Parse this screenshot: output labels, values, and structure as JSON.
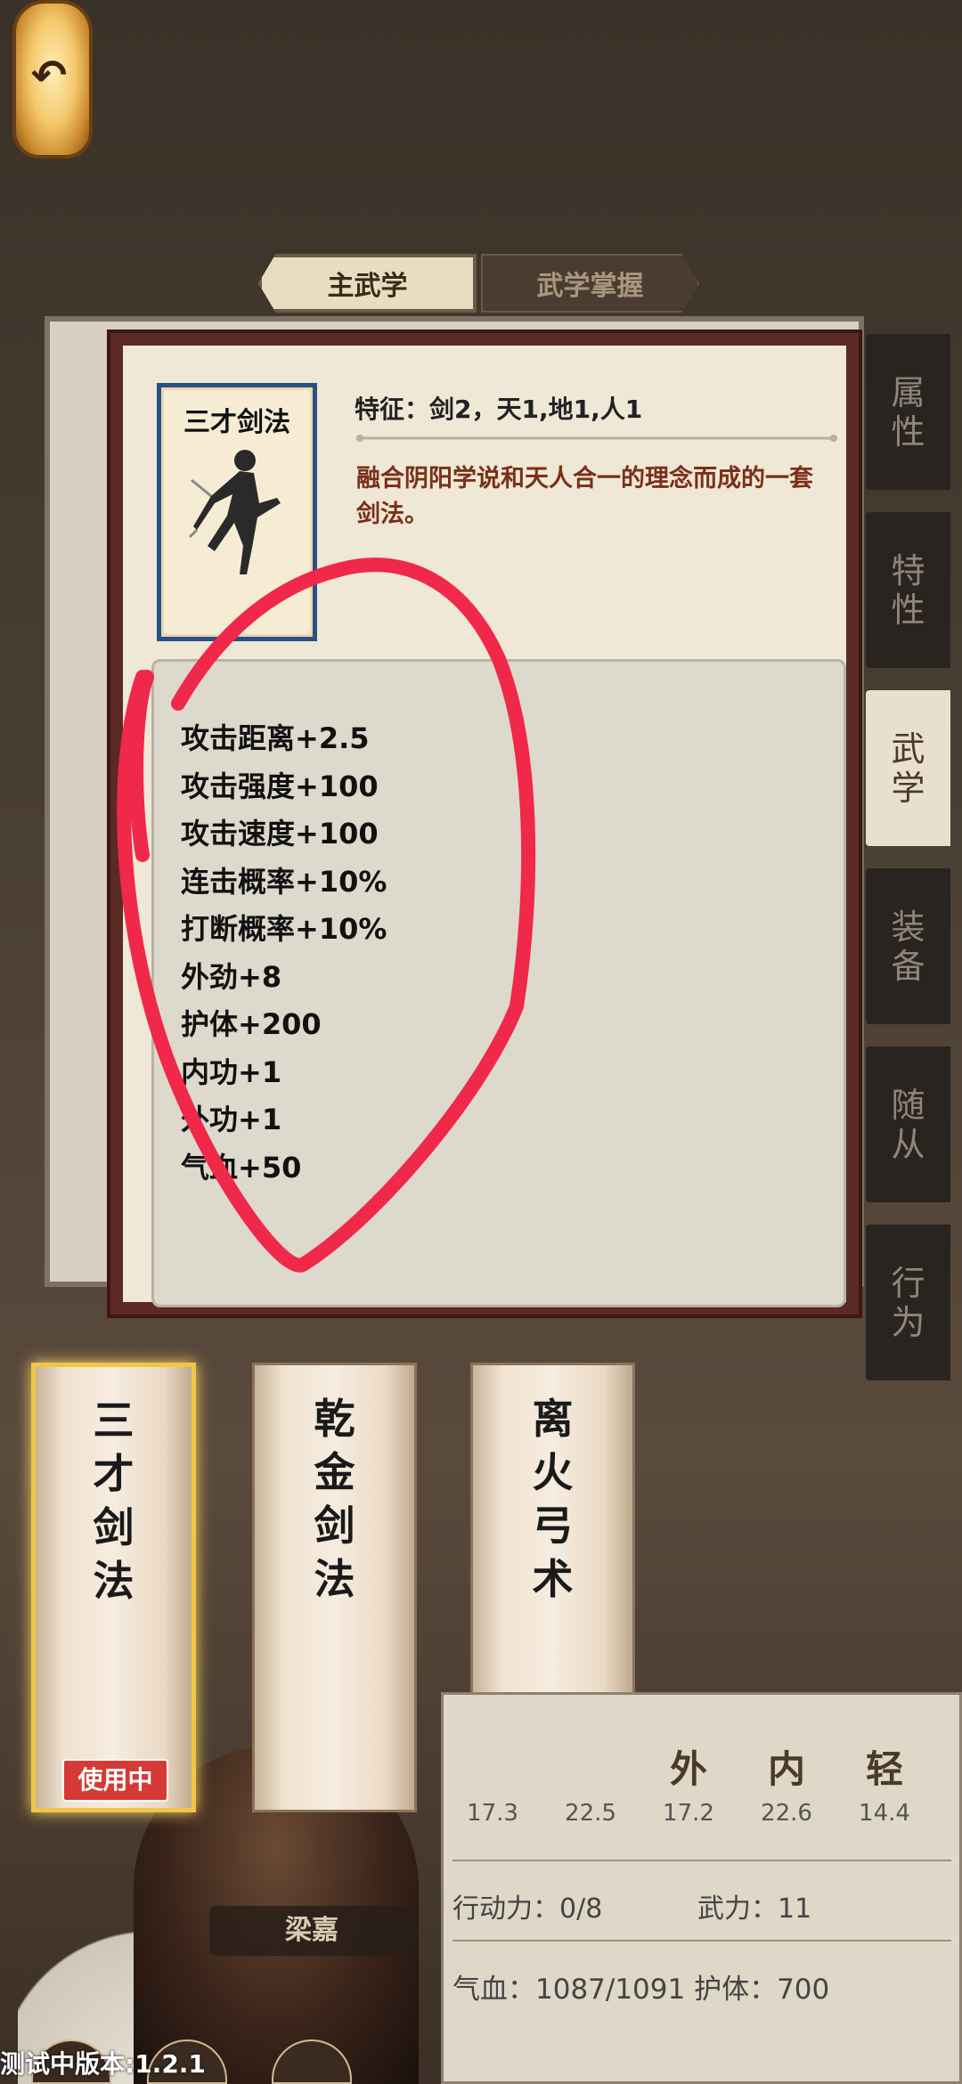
{
  "tabs": {
    "main": "主武学",
    "master": "武学掌握"
  },
  "side_tabs": [
    "属性",
    "特性",
    "武学",
    "装备",
    "随从",
    "行为"
  ],
  "active_side_tab": "武学",
  "popup": {
    "skill_name": "三才剑法",
    "feature": "特征：剑2，天1,地1,人1",
    "description": "融合阴阳学说和天人合一的理念而成的一套剑法。",
    "stats": [
      "攻击距离+2.5",
      "攻击强度+100",
      "攻击速度+100",
      "连击概率+10%",
      "打断概率+10%",
      "外劲+8",
      "护体+200",
      "内功+1",
      "外功+1",
      "气血+50"
    ]
  },
  "skills": [
    {
      "name": "三才剑法",
      "badge": "使用中"
    },
    {
      "name": "乾金剑法"
    },
    {
      "name": "离火弓术"
    }
  ],
  "character": {
    "name": "梁嘉",
    "attributes": [
      {
        "label": "",
        "value": "17.3"
      },
      {
        "label": "",
        "value": "22.5"
      },
      {
        "label": "外",
        "value": "17.2"
      },
      {
        "label": "内",
        "value": "22.6"
      },
      {
        "label": "轻",
        "value": "14.4"
      }
    ],
    "action_power": "行动力：0/8",
    "martial_power": "武力：11",
    "hp_line": "气血：1087/1091 护体：700"
  },
  "version": "测试中版本:1.2.1",
  "colors": {
    "annotation": "#f0284a",
    "popup_frame": "#5b2a24",
    "selected_glow": "#f0c646"
  }
}
